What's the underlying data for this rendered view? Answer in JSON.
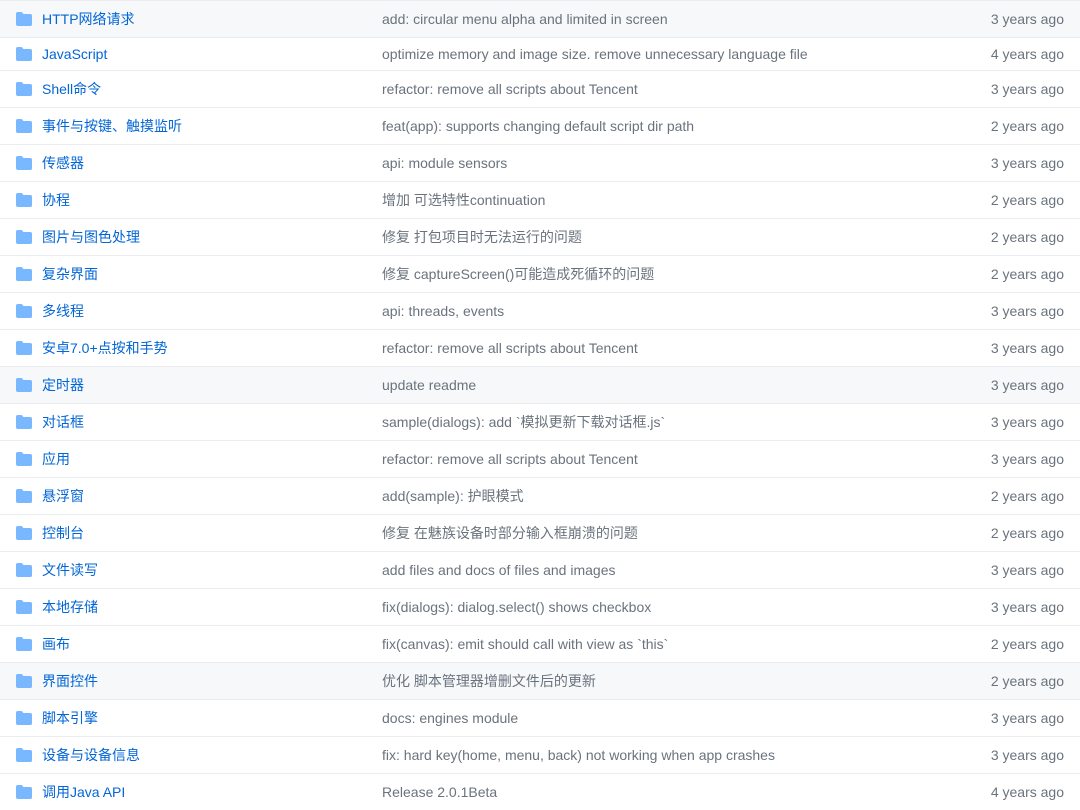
{
  "rows": [
    {
      "name": "HTTP网络请求",
      "message": "add: circular menu alpha and limited in screen",
      "age": "3 years ago",
      "highlighted": false
    },
    {
      "name": "JavaScript",
      "message": "optimize memory and image size. remove unnecessary language file",
      "age": "4 years ago",
      "highlighted": false
    },
    {
      "name": "Shell命令",
      "message": "refactor: remove all scripts about Tencent",
      "age": "3 years ago",
      "highlighted": false
    },
    {
      "name": "事件与按键、触摸监听",
      "message": "feat(app): supports changing default script dir path",
      "age": "2 years ago",
      "highlighted": false
    },
    {
      "name": "传感器",
      "message": "api: module sensors",
      "age": "3 years ago",
      "highlighted": false
    },
    {
      "name": "协程",
      "message": "增加 可选特性continuation",
      "age": "2 years ago",
      "highlighted": false
    },
    {
      "name": "图片与图色处理",
      "message": "修复 打包项目时无法运行的问题",
      "age": "2 years ago",
      "highlighted": false
    },
    {
      "name": "复杂界面",
      "message": "修复 captureScreen()可能造成死循环的问题",
      "age": "2 years ago",
      "highlighted": false
    },
    {
      "name": "多线程",
      "message": "api: threads, events",
      "age": "3 years ago",
      "highlighted": false
    },
    {
      "name": "安卓7.0+点按和手势",
      "message": "refactor: remove all scripts about Tencent",
      "age": "3 years ago",
      "highlighted": false
    },
    {
      "name": "定时器",
      "message": "update readme",
      "age": "3 years ago",
      "highlighted": true
    },
    {
      "name": "对话框",
      "message": "sample(dialogs): add `模拟更新下载对话框.js`",
      "age": "3 years ago",
      "highlighted": false
    },
    {
      "name": "应用",
      "message": "refactor: remove all scripts about Tencent",
      "age": "3 years ago",
      "highlighted": false
    },
    {
      "name": "悬浮窗",
      "message": "add(sample): 护眼模式",
      "age": "2 years ago",
      "highlighted": false
    },
    {
      "name": "控制台",
      "message": "修复 在魅族设备时部分输入框崩溃的问题",
      "age": "2 years ago",
      "highlighted": false
    },
    {
      "name": "文件读写",
      "message": "add files and docs of files and images",
      "age": "3 years ago",
      "highlighted": false
    },
    {
      "name": "本地存储",
      "message": "fix(dialogs): dialog.select() shows checkbox",
      "age": "3 years ago",
      "highlighted": false
    },
    {
      "name": "画布",
      "message": "fix(canvas): emit should call with view as `this`",
      "age": "2 years ago",
      "highlighted": false
    },
    {
      "name": "界面控件",
      "message": "优化 脚本管理器增删文件后的更新",
      "age": "2 years ago",
      "highlighted": true
    },
    {
      "name": "脚本引擎",
      "message": "docs: engines module",
      "age": "3 years ago",
      "highlighted": false
    },
    {
      "name": "设备与设备信息",
      "message": "fix: hard key(home, menu, back) not working when app crashes",
      "age": "3 years ago",
      "highlighted": false
    },
    {
      "name": "调用Java API",
      "message": "Release 2.0.1Beta",
      "age": "4 years ago",
      "highlighted": false
    }
  ]
}
